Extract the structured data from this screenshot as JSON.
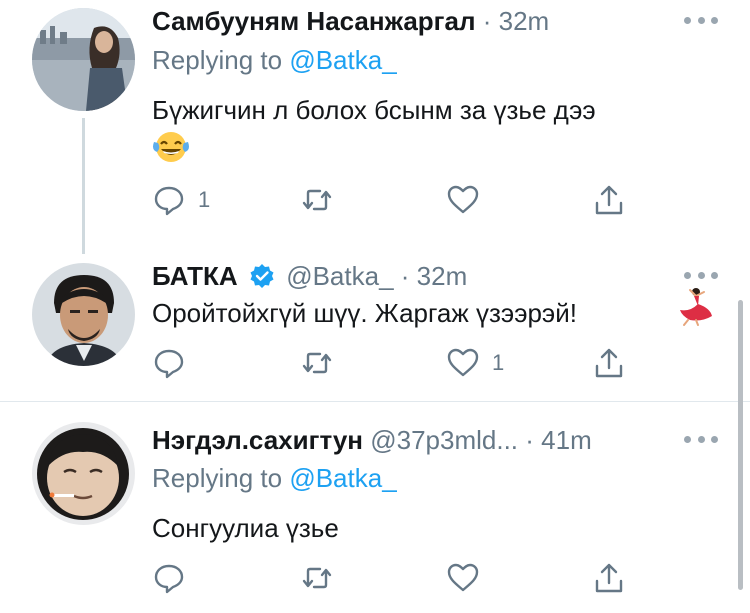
{
  "tweets": [
    {
      "display_name": "Самбууням Насанжаргал",
      "separator": "·",
      "time": "32m",
      "replying_prefix": "Replying to",
      "replying_to": "@Batka_",
      "text": "Бүжигчин л болох бсынм за үзье дээ",
      "emoji": "face-with-tears-of-joy",
      "reply_count": "1",
      "like_count": ""
    },
    {
      "display_name": "БАТКА",
      "handle": "@Batka_",
      "separator": "·",
      "time": "32m",
      "text": "Оройтойхгүй шүү. Жаргаж үзээрэй!",
      "emoji": "woman-dancing",
      "reply_count": "",
      "like_count": "1"
    },
    {
      "display_name": "Нэгдэл.сахигтун",
      "handle": "@37p3mld...",
      "separator": "·",
      "time": "41m",
      "replying_prefix": "Replying to",
      "replying_to": "@Batka_",
      "text": "Сонгуулиа үзье",
      "reply_count": "",
      "like_count": ""
    }
  ],
  "icons": [
    "reply-icon",
    "retweet-icon",
    "like-icon",
    "share-icon",
    "more-icon",
    "verified-badge-icon"
  ],
  "colors": {
    "accent": "#1da1f2",
    "secondary_text": "#657786",
    "primary_text": "#14171a",
    "icon": "#657786",
    "divider": "#e1e8ed",
    "thread_line": "#cfd9de"
  }
}
